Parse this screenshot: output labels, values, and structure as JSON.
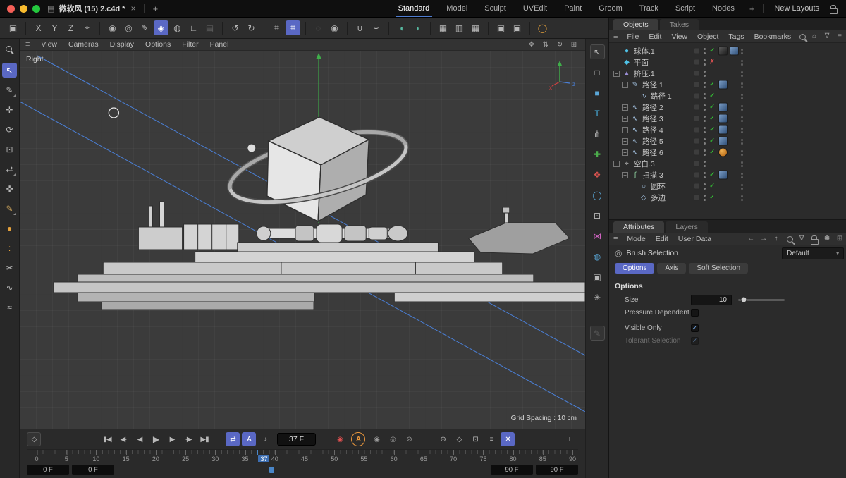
{
  "titlebar": {
    "doc_icon": "▤",
    "doc_title": "微软风  (15)  2.c4d *",
    "close_tab": "×",
    "add_tab": "+",
    "layout_menus": [
      "Standard",
      "Model",
      "Sculpt",
      "UVEdit",
      "Paint",
      "Groom",
      "Track",
      "Script",
      "Nodes"
    ],
    "active_layout": "Standard",
    "add_layout": "+",
    "new_layouts_label": "New Layouts"
  },
  "toolbar": {
    "groups": [
      [
        {
          "n": "viewport-frame-icon",
          "g": "▣"
        }
      ],
      [
        {
          "n": "x-axis-lock-button",
          "g": "X"
        },
        {
          "n": "y-axis-lock-button",
          "g": "Y"
        },
        {
          "n": "z-axis-lock-button",
          "g": "Z"
        },
        {
          "n": "coordinate-system-button",
          "g": "⌖"
        }
      ],
      [
        {
          "n": "modeling-axis-icon",
          "g": "◉"
        },
        {
          "n": "ring-tool-icon",
          "g": "◎"
        },
        {
          "n": "pen-tool-icon",
          "g": "✎"
        },
        {
          "n": "polygon-mode-button",
          "g": "◈",
          "hl": true
        },
        {
          "n": "paint-sphere-icon",
          "g": "◍"
        },
        {
          "n": "angle-tool-icon",
          "g": "∟"
        },
        {
          "n": "box-tool-icon",
          "g": "▤",
          "dim": true
        }
      ],
      [
        {
          "n": "view-undo-icon",
          "g": "↺"
        },
        {
          "n": "view-redo-icon",
          "g": "↻"
        }
      ],
      [
        {
          "n": "grid-snap-icon",
          "g": "⌗"
        },
        {
          "n": "grid-quantize-button",
          "g": "⌗",
          "hl": true
        }
      ],
      [
        {
          "n": "render-disabled-icon",
          "g": "◌",
          "dim": true
        },
        {
          "n": "render-view-button",
          "g": "◉"
        }
      ],
      [
        {
          "n": "snap-magnet-icon",
          "g": "∪"
        },
        {
          "n": "snap-arc-icon",
          "g": "⌣"
        }
      ],
      [
        {
          "n": "capsule-left-icon",
          "g": "◖",
          "c": "#57b8a0"
        },
        {
          "n": "capsule-right-icon",
          "g": "◗",
          "c": "#57b8a0"
        }
      ],
      [
        {
          "n": "render-film-icon",
          "g": "▦"
        },
        {
          "n": "render-settings-icon",
          "g": "▥"
        },
        {
          "n": "render-queue-icon",
          "g": "▦"
        }
      ],
      [
        {
          "n": "save-project-icon",
          "g": "▣"
        },
        {
          "n": "save-incremental-icon",
          "g": "▣"
        }
      ],
      [
        {
          "n": "material-ring-icon",
          "g": "◯",
          "c": "#e6a23c"
        }
      ]
    ]
  },
  "left_toolbar": {
    "tools": [
      {
        "n": "search-tool-button",
        "g": "css-search"
      },
      {
        "n": "select-tool-button",
        "g": "↖",
        "sel": true
      },
      {
        "n": "brush-select-tool-button",
        "g": "✎",
        "fly": true
      },
      {
        "n": "move-tool-button",
        "g": "✛"
      },
      {
        "n": "rotate-tool-button",
        "g": "⟳"
      },
      {
        "n": "scale-tool-button",
        "g": "⊡"
      },
      {
        "n": "swap-tool-button",
        "g": "⇄",
        "fly": true
      },
      {
        "n": "transform-tool-button",
        "g": "✜"
      },
      {
        "n": "spline-pen-tool-button",
        "g": "✎",
        "fly": true,
        "c": "#c9a15a"
      },
      {
        "n": "paint-dot-tool-button",
        "g": "●",
        "c": "#e6a23c"
      },
      {
        "n": "paint-dots-tool-button",
        "g": ":",
        "c": "#e6a23c"
      },
      {
        "n": "knife-tool-button",
        "g": "✂"
      },
      {
        "n": "curve-pen-tool-button",
        "g": "∿"
      },
      {
        "n": "spline-smooth-tool-button",
        "g": "≈"
      }
    ]
  },
  "right_strip": {
    "tools": [
      {
        "n": "pointer-mode-button",
        "g": "↖",
        "box": true
      },
      {
        "n": "model-mode-button",
        "g": "□"
      },
      {
        "n": "object-mode-button",
        "g": "■",
        "c": "#5aa7d8"
      },
      {
        "n": "texture-mode-button",
        "g": "T",
        "c": "#49b6e8"
      },
      {
        "n": "rig-mode-button",
        "g": "⋔"
      },
      {
        "n": "add-tree-button",
        "g": "✚",
        "c": "#4cae4c"
      },
      {
        "n": "cluster-mode-button",
        "g": "❖",
        "c": "#d9534f"
      },
      {
        "n": "torus-mode-button",
        "g": "◯",
        "c": "#5aa7d8"
      },
      {
        "n": "workplane-mode-button",
        "g": "⊡"
      },
      {
        "n": "magnet-mode-button",
        "g": "⋈",
        "c": "#d666c8"
      },
      {
        "n": "globe-mode-button",
        "g": "◍",
        "c": "#5aa7d8"
      },
      {
        "n": "camera-mode-button",
        "g": "▣"
      },
      {
        "n": "star-mode-button",
        "g": "✳"
      },
      {
        "sp": true
      },
      {
        "n": "note-tool-button",
        "g": "✎",
        "dim": true,
        "box": true
      }
    ]
  },
  "viewport": {
    "view_label": "Right",
    "menus": [
      "View",
      "Cameras",
      "Display",
      "Options",
      "Filter",
      "Panel"
    ],
    "nav_icons": [
      {
        "n": "pan-view-icon",
        "g": "✥"
      },
      {
        "n": "dolly-view-icon",
        "g": "⇅"
      },
      {
        "n": "rotate-view-icon",
        "g": "↻"
      },
      {
        "n": "maximize-view-icon",
        "g": "⊞"
      }
    ],
    "grid_spacing": "Grid Spacing : 10 cm",
    "axis": {
      "x_label": "x",
      "z_label": "z"
    }
  },
  "objects": {
    "tabs": [
      "Objects",
      "Takes"
    ],
    "active_tab": "Objects",
    "menus": [
      "File",
      "Edit",
      "View",
      "Object",
      "Tags",
      "Bookmarks"
    ],
    "menu_icons": [
      {
        "n": "search-icon",
        "g": "css-search"
      },
      {
        "n": "home-icon",
        "g": "⌂"
      },
      {
        "n": "filter-icon",
        "g": "∇"
      },
      {
        "n": "list-icon",
        "g": "≡"
      }
    ],
    "tree": [
      {
        "name": "sphere-1",
        "label": "球体.1",
        "icon": "sphere-icon",
        "g": "●",
        "c": "#4fc3e8",
        "level": 0,
        "check": "on",
        "thumbs": [
          "dark",
          "blue"
        ]
      },
      {
        "name": "plane",
        "label": "平面",
        "icon": "plane-icon",
        "g": "◆",
        "c": "#4fc3e8",
        "level": 0,
        "check": "off",
        "thumbs": []
      },
      {
        "name": "extrude-1",
        "label": "挤压.1",
        "icon": "extrude-icon",
        "g": "▲",
        "c": "#9c8fd8",
        "level": 0,
        "exp": "-",
        "thumbs": []
      },
      {
        "name": "path-1",
        "label": "路径 1",
        "icon": "spline-icon",
        "g": "✎",
        "c": "#a8c8e8",
        "level": 1,
        "exp": "-",
        "check": "on",
        "thumbs": [
          "blue"
        ]
      },
      {
        "name": "path-1-child",
        "label": "路径 1",
        "icon": "spline-icon",
        "g": "∿",
        "c": "#a8c8e8",
        "level": 2,
        "check": "on",
        "thumbs": []
      },
      {
        "name": "path-2",
        "label": "路径 2",
        "icon": "spline-icon",
        "g": "∿",
        "c": "#a8c8e8",
        "level": 1,
        "exp": "+",
        "check": "on",
        "thumbs": [
          "blue"
        ]
      },
      {
        "name": "path-3",
        "label": "路径 3",
        "icon": "spline-icon",
        "g": "∿",
        "c": "#a8c8e8",
        "level": 1,
        "exp": "+",
        "check": "on",
        "thumbs": [
          "blue"
        ]
      },
      {
        "name": "path-4",
        "label": "路径 4",
        "icon": "spline-icon",
        "g": "∿",
        "c": "#a8c8e8",
        "level": 1,
        "exp": "+",
        "check": "on",
        "thumbs": [
          "blue"
        ]
      },
      {
        "name": "path-5",
        "label": "路径 5",
        "icon": "spline-icon",
        "g": "∿",
        "c": "#a8c8e8",
        "level": 1,
        "exp": "+",
        "check": "on",
        "thumbs": [
          "blue"
        ]
      },
      {
        "name": "path-6",
        "label": "路径 6",
        "icon": "spline-icon",
        "g": "∿",
        "c": "#a8c8e8",
        "level": 1,
        "exp": "+",
        "check": "on",
        "thumbs": [
          "orange"
        ]
      },
      {
        "name": "null-3",
        "label": "空白.3",
        "icon": "null-icon",
        "g": "⌖",
        "c": "#bababa",
        "level": 0,
        "exp": "-",
        "thumbs": []
      },
      {
        "name": "sweep-3",
        "label": "扫描.3",
        "icon": "sweep-icon",
        "g": "∫",
        "c": "#8fd09f",
        "level": 1,
        "exp": "-",
        "check": "on",
        "thumbs": [
          "blue"
        ]
      },
      {
        "name": "circle",
        "label": "圆环",
        "icon": "circle-spline-icon",
        "g": "○",
        "c": "#a8c8e8",
        "level": 2,
        "check": "on",
        "thumbs": []
      },
      {
        "name": "n-side",
        "label": "多边",
        "icon": "nside-icon",
        "g": "◇",
        "c": "#a8c8e8",
        "level": 2,
        "check": "on",
        "thumbs": []
      }
    ]
  },
  "attributes": {
    "tabs": [
      "Attributes",
      "Layers"
    ],
    "active_tab": "Attributes",
    "menus": [
      "Mode",
      "Edit",
      "User Data"
    ],
    "menu_icons": [
      {
        "n": "back-icon",
        "g": "←"
      },
      {
        "n": "forward-icon",
        "g": "→"
      },
      {
        "n": "up-icon",
        "g": "↑"
      },
      {
        "n": "search-icon",
        "g": "css-search"
      },
      {
        "n": "filter-icon",
        "g": "∇"
      },
      {
        "n": "lock-icon",
        "g": "css-lock"
      },
      {
        "n": "gear-icon",
        "g": "✱"
      },
      {
        "n": "panel-icon",
        "g": "⊞"
      }
    ],
    "object_title": "Brush Selection",
    "preset_dropdown": "Default",
    "dropdown_arrow": "▾",
    "tab_buttons": [
      "Options",
      "Axis",
      "Soft Selection"
    ],
    "active_tab_button": "Options",
    "section_title": "Options",
    "size_label": "Size",
    "size_value": "10",
    "size_slider_pos": 12,
    "pressure_label": "Pressure Dependent",
    "pressure_checked": false,
    "visible_label": "Visible Only",
    "visible_checked": true,
    "tolerant_label": "Tolerant Selection",
    "tolerant_checked": true
  },
  "timeline": {
    "keyframe_button": {
      "n": "keyframe-selection-button",
      "g": "◇"
    },
    "transport": [
      {
        "n": "go-to-start-button",
        "g": "▮◀"
      },
      {
        "n": "previous-key-button",
        "g": "◀·"
      },
      {
        "n": "previous-frame-button",
        "g": "◀"
      },
      {
        "n": "play-button",
        "g": "▶",
        "play": true
      },
      {
        "n": "next-frame-button",
        "g": "▶"
      },
      {
        "n": "next-key-button",
        "g": "·▶"
      },
      {
        "n": "go-to-end-button",
        "g": "▶▮"
      }
    ],
    "mode_buttons": [
      {
        "n": "cycle-button",
        "g": "⇄",
        "hl": true
      },
      {
        "n": "autokey-range-button",
        "g": "A",
        "hl": true
      },
      {
        "n": "sound-button",
        "g": "♪"
      }
    ],
    "frame_display": "37 F",
    "record_buttons": [
      {
        "n": "record-keyframe-button",
        "g": "◉",
        "c": "#e05050"
      },
      {
        "n": "autokey-toggle-button",
        "g": "A",
        "c": "#e8963c",
        "circle": true
      },
      {
        "n": "record-position-button",
        "g": "◉",
        "c": "#9a9a9a"
      },
      {
        "n": "record-scale-button",
        "g": "◎",
        "c": "#9a9a9a"
      },
      {
        "n": "record-rotation-button",
        "g": "⊘",
        "c": "#9a9a9a"
      }
    ],
    "extra_buttons": [
      {
        "n": "snap-keys-button",
        "g": "⊕"
      },
      {
        "n": "marker-button",
        "g": "◇"
      },
      {
        "n": "region-button",
        "g": "⊡"
      },
      {
        "n": "motion-layers-button",
        "g": "≡"
      },
      {
        "n": "filter-keys-button",
        "g": "✕",
        "hl": true
      }
    ],
    "corner_icon": {
      "n": "timeline-corner-icon",
      "g": "∟"
    },
    "ruler": {
      "min": 0,
      "max": 90,
      "ticks": [
        0,
        5,
        10,
        15,
        20,
        25,
        30,
        35,
        40,
        45,
        50,
        55,
        60,
        65,
        70,
        75,
        80,
        85,
        90
      ],
      "current": 37,
      "current_label": "37"
    },
    "bounds": {
      "start_a": "0 F",
      "start_b": "0 F",
      "end_a": "90 F",
      "end_b": "90 F"
    }
  }
}
